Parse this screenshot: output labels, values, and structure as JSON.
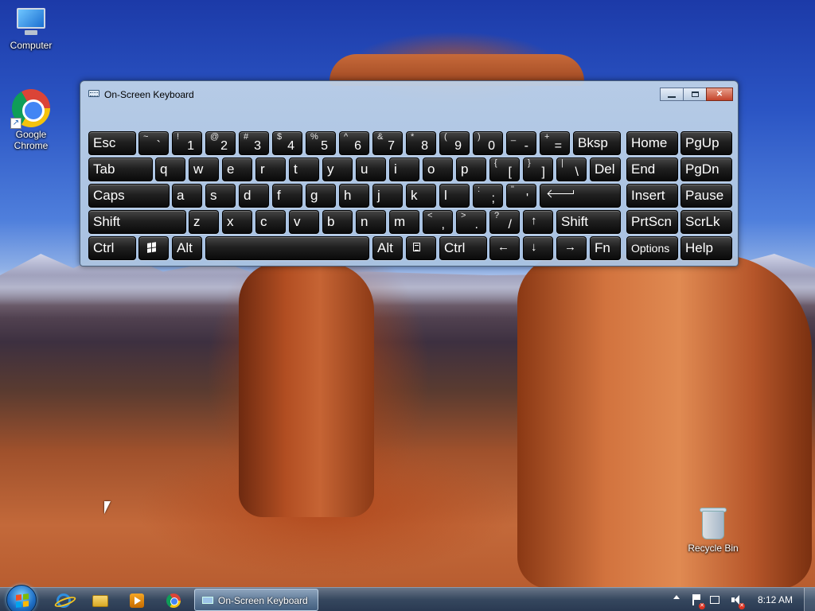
{
  "desktop": {
    "icons": [
      {
        "label": "Computer"
      },
      {
        "label": "Google Chrome"
      },
      {
        "label": "Recycle Bin"
      }
    ]
  },
  "osk": {
    "title": "On-Screen Keyboard",
    "title_icon": "keyboard-icon",
    "rows": [
      [
        {
          "main": "Esc",
          "name": "esc"
        },
        {
          "shift": "~",
          "base": "`",
          "name": "backtick"
        },
        {
          "shift": "!",
          "base": "1",
          "name": "1"
        },
        {
          "shift": "@",
          "base": "2",
          "name": "2"
        },
        {
          "shift": "#",
          "base": "3",
          "name": "3"
        },
        {
          "shift": "$",
          "base": "4",
          "name": "4"
        },
        {
          "shift": "%",
          "base": "5",
          "name": "5"
        },
        {
          "shift": "^",
          "base": "6",
          "name": "6"
        },
        {
          "shift": "&",
          "base": "7",
          "name": "7"
        },
        {
          "shift": "*",
          "base": "8",
          "name": "8"
        },
        {
          "shift": "(",
          "base": "9",
          "name": "9"
        },
        {
          "shift": ")",
          "base": "0",
          "name": "0"
        },
        {
          "shift": "_",
          "base": "-",
          "name": "minus"
        },
        {
          "shift": "+",
          "base": "=",
          "name": "equals"
        },
        {
          "main": "Bksp",
          "name": "backspace"
        },
        {
          "main": "Home",
          "name": "home"
        },
        {
          "main": "PgUp",
          "name": "pgup"
        }
      ],
      [
        {
          "main": "Tab",
          "name": "tab"
        },
        {
          "main": "q",
          "name": "q"
        },
        {
          "main": "w",
          "name": "w"
        },
        {
          "main": "e",
          "name": "e"
        },
        {
          "main": "r",
          "name": "r"
        },
        {
          "main": "t",
          "name": "t"
        },
        {
          "main": "y",
          "name": "y"
        },
        {
          "main": "u",
          "name": "u"
        },
        {
          "main": "i",
          "name": "i"
        },
        {
          "main": "o",
          "name": "o"
        },
        {
          "main": "p",
          "name": "p"
        },
        {
          "shift": "{",
          "base": "[",
          "name": "lbracket"
        },
        {
          "shift": "}",
          "base": "]",
          "name": "rbracket"
        },
        {
          "shift": "|",
          "base": "\\",
          "name": "backslash"
        },
        {
          "main": "Del",
          "name": "del"
        },
        {
          "main": "End",
          "name": "end"
        },
        {
          "main": "PgDn",
          "name": "pgdn"
        }
      ],
      [
        {
          "main": "Caps",
          "name": "caps"
        },
        {
          "main": "a",
          "name": "a"
        },
        {
          "main": "s",
          "name": "s"
        },
        {
          "main": "d",
          "name": "d"
        },
        {
          "main": "f",
          "name": "f"
        },
        {
          "main": "g",
          "name": "g"
        },
        {
          "main": "h",
          "name": "h"
        },
        {
          "main": "j",
          "name": "j"
        },
        {
          "main": "k",
          "name": "k"
        },
        {
          "main": "l",
          "name": "l"
        },
        {
          "shift": ":",
          "base": ";",
          "name": "semicolon"
        },
        {
          "shift": "\"",
          "base": "'",
          "name": "quote"
        },
        {
          "icon": "enter-arrow-icon",
          "name": "enter"
        },
        {
          "main": "Insert",
          "name": "insert"
        },
        {
          "main": "Pause",
          "name": "pause"
        }
      ],
      [
        {
          "main": "Shift",
          "name": "lshift"
        },
        {
          "main": "z",
          "name": "z"
        },
        {
          "main": "x",
          "name": "x"
        },
        {
          "main": "c",
          "name": "c"
        },
        {
          "main": "v",
          "name": "v"
        },
        {
          "main": "b",
          "name": "b"
        },
        {
          "main": "n",
          "name": "n"
        },
        {
          "main": "m",
          "name": "m"
        },
        {
          "shift": "<",
          "base": ",",
          "name": "comma"
        },
        {
          "shift": ">",
          "base": ".",
          "name": "period"
        },
        {
          "shift": "?",
          "base": "/",
          "name": "slash"
        },
        {
          "glyph": "↑",
          "name": "up"
        },
        {
          "main": "Shift",
          "name": "rshift"
        },
        {
          "main": "PrtScn",
          "name": "prtscn"
        },
        {
          "main": "ScrLk",
          "name": "scrlk"
        }
      ],
      [
        {
          "main": "Ctrl",
          "name": "lctrl"
        },
        {
          "icon": "windows-logo-icon",
          "name": "win"
        },
        {
          "main": "Alt",
          "name": "lalt"
        },
        {
          "main": "",
          "name": "space"
        },
        {
          "main": "Alt",
          "name": "ralt"
        },
        {
          "icon": "context-menu-icon",
          "name": "menu"
        },
        {
          "main": "Ctrl",
          "name": "rctrl"
        },
        {
          "glyph": "←",
          "name": "left"
        },
        {
          "glyph": "↓",
          "name": "down"
        },
        {
          "glyph": "→",
          "name": "right"
        },
        {
          "main": "Fn",
          "name": "fn"
        },
        {
          "main": "Options",
          "small": true,
          "name": "options"
        },
        {
          "main": "Help",
          "name": "help"
        }
      ]
    ]
  },
  "taskbar": {
    "start_icon": "windows-start-orb-icon",
    "pinned": [
      {
        "icon": "internet-explorer-icon"
      },
      {
        "icon": "windows-explorer-icon"
      },
      {
        "icon": "media-player-icon"
      },
      {
        "icon": "chrome-icon"
      }
    ],
    "task": {
      "label": "On-Screen Keyboard",
      "icon": "keyboard-icon"
    },
    "tray": {
      "icons": [
        "show-hidden-icons-icon",
        "action-center-flag-icon",
        "network-icon",
        "volume-icon"
      ]
    },
    "clock": "8:12 AM"
  }
}
